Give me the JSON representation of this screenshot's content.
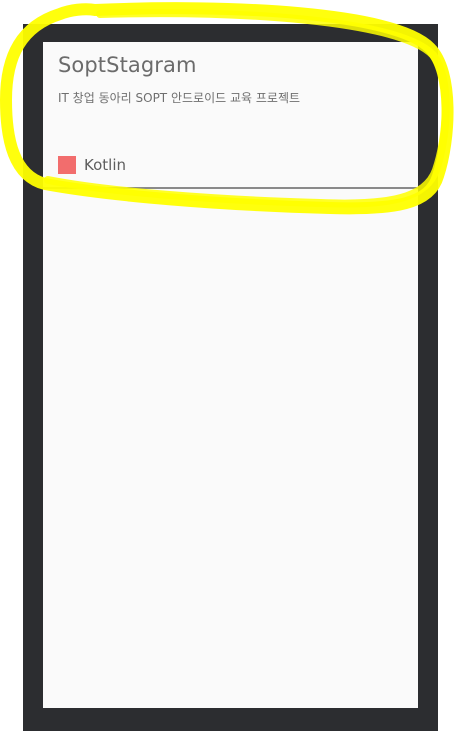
{
  "app": {
    "title": "SoptStagram",
    "subtitle": "IT 창업 동아리 SOPT 안드로이드 교육 프로젝트"
  },
  "language": {
    "label": "Kotlin",
    "color": "#f26d6d"
  },
  "colors": {
    "frame": "#2c2d30",
    "screen": "#fafafa",
    "highlight": "#ffff00"
  }
}
